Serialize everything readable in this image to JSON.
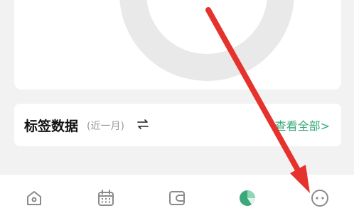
{
  "tag_section": {
    "title": "标签数据",
    "period": "(近一月)",
    "view_all": "查看全部>"
  },
  "colors": {
    "accent": "#3aa87a",
    "icon_gray": "#8a8a8a",
    "annotation_arrow": "#e5322d",
    "donut_ring": "#e9e9e9"
  },
  "tabbar": {
    "items": [
      {
        "icon": "home-icon",
        "active": false
      },
      {
        "icon": "calendar-icon",
        "active": false
      },
      {
        "icon": "wallet-icon",
        "active": false
      },
      {
        "icon": "pie-chart-icon",
        "active": true
      },
      {
        "icon": "more-icon",
        "active": false
      }
    ]
  }
}
